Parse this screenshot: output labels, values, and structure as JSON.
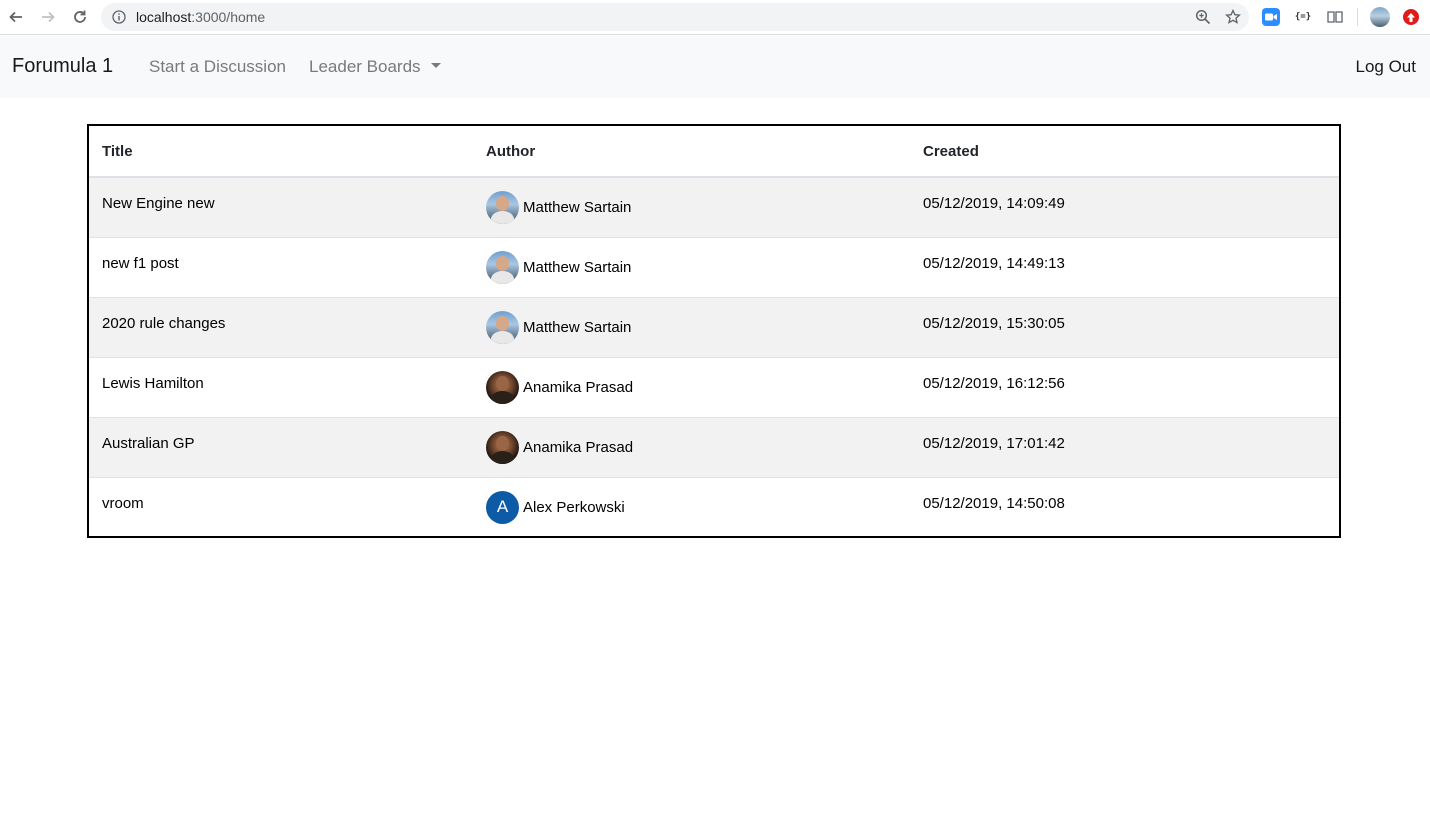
{
  "browser": {
    "url_host": "localhost",
    "url_path": ":3000/home",
    "ext_json_label": "{=}"
  },
  "navbar": {
    "brand": "Forumula 1",
    "start_discussion": "Start a Discussion",
    "leader_boards": "Leader Boards",
    "logout": "Log Out"
  },
  "table": {
    "headers": [
      "Title",
      "Author",
      "Created"
    ],
    "rows": [
      {
        "title": "New Engine new",
        "author": "Matthew Sartain",
        "avatar": "photo-m",
        "created": "05/12/2019, 14:09:49"
      },
      {
        "title": "new f1 post",
        "author": "Matthew Sartain",
        "avatar": "photo-m",
        "created": "05/12/2019, 14:49:13"
      },
      {
        "title": "2020 rule changes",
        "author": "Matthew Sartain",
        "avatar": "photo-m",
        "created": "05/12/2019, 15:30:05"
      },
      {
        "title": "Lewis Hamilton",
        "author": "Anamika Prasad",
        "avatar": "photo-f",
        "created": "05/12/2019, 16:12:56"
      },
      {
        "title": "Australian GP",
        "author": "Anamika Prasad",
        "avatar": "photo-f",
        "created": "05/12/2019, 17:01:42"
      },
      {
        "title": "vroom",
        "author": "Alex Perkowski",
        "avatar": "letter",
        "avatar_letter": "A",
        "created": "05/12/2019, 14:50:08"
      }
    ]
  },
  "colors": {
    "navbar_bg": "#f8f9fa",
    "stripe_bg": "#f2f2f2",
    "letter_avatar_bg": "#0d5aa7"
  }
}
